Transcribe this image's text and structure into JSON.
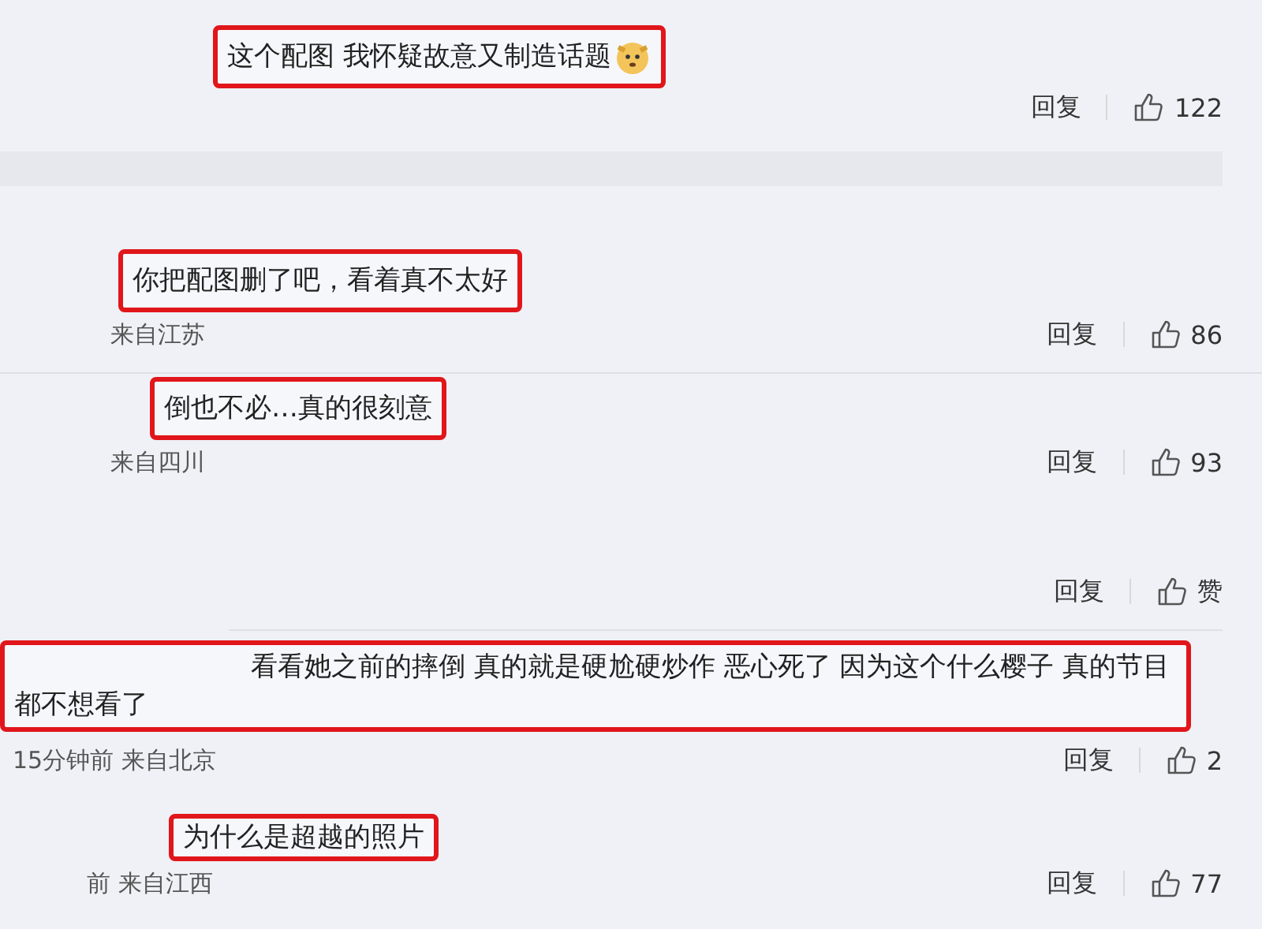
{
  "comments": [
    {
      "text": "这个配图 我怀疑故意又制造话题",
      "emoji": true,
      "reply": "回复",
      "likes": "122"
    },
    {
      "text": "你把配图删了吧，看着真不太好",
      "meta": "来自江苏",
      "reply": "回复",
      "likes": "86"
    },
    {
      "text": "倒也不必…真的很刻意",
      "meta": "来自四川",
      "reply": "回复",
      "likes": "93"
    },
    {
      "reply": "回复",
      "likes": "赞"
    },
    {
      "text": "看看她之前的摔倒 真的就是硬尬硬炒作 恶心死了 因为这个什么樱子 真的节目都不想看了",
      "meta": "15分钟前 来自北京",
      "reply": "回复",
      "likes": "2"
    },
    {
      "text": "为什么是超越的照片",
      "meta": "前 来自江西",
      "reply": "回复",
      "likes": "77"
    }
  ]
}
